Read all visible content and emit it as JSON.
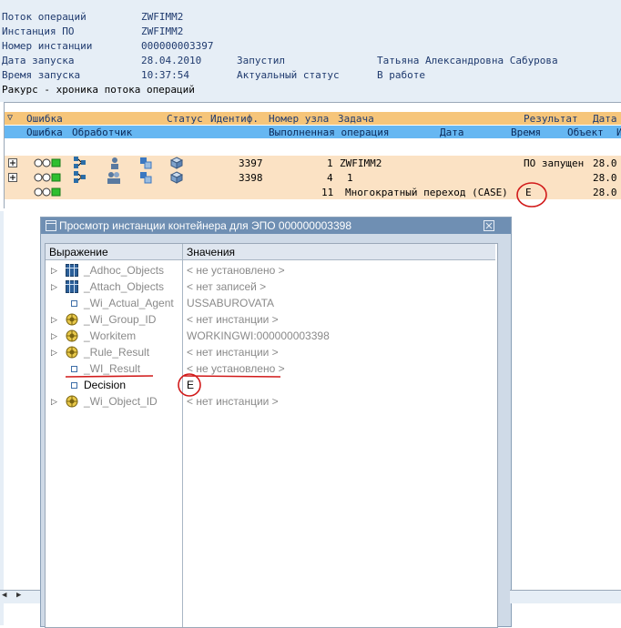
{
  "header": {
    "rows": [
      {
        "label": "Поток операций",
        "value": "ZWFIMM2"
      },
      {
        "label": "Инстанция ПО",
        "value": "ZWFIMM2"
      },
      {
        "label": "Номер инстанции",
        "value": "000000003397"
      },
      {
        "label": "Дата запуска",
        "value": "28.04.2010",
        "label2": "Запустил",
        "value2": "Татьяна Александровна Сабурова"
      },
      {
        "label": "Время запуска",
        "value": "10:37:54",
        "label2": "Актуальный статус",
        "value2": "В работе"
      }
    ],
    "section_title": "Ракурс - хроника потока операций"
  },
  "table": {
    "header1": [
      "Ошибка",
      "Статус",
      "Идентиф.",
      "Номер узла",
      "Задача",
      "Результат",
      "Дата"
    ],
    "header2": [
      "Ошибка",
      "Обработчик",
      "Выполненная операция",
      "Дата",
      "Время",
      "Объект",
      "И"
    ],
    "rows": [
      {
        "id": "3397",
        "node": "1",
        "task": "ZWFIMM2",
        "result": "ПО запущен",
        "date": "28.0"
      },
      {
        "id": "3398",
        "node": "4",
        "task": "1",
        "result": "",
        "date": "28.0"
      },
      {
        "id": "",
        "node": "11",
        "task": "Многократный переход (CASE)",
        "result": "E",
        "date": "28.0"
      }
    ]
  },
  "dialog": {
    "title": "Просмотр инстанции контейнера для ЭПО 000000003398",
    "col_expression": "Выражение",
    "col_values": "Значения",
    "rows": [
      {
        "name": "_Adhoc_Objects",
        "value": "< не установлено >",
        "icon": "table-icon",
        "expand": true
      },
      {
        "name": "_Attach_Objects",
        "value": "< нет записей >",
        "icon": "table-icon",
        "expand": true
      },
      {
        "name": "_Wi_Actual_Agent",
        "value": "USSABUROVATA",
        "icon": "square-icon",
        "expand": false
      },
      {
        "name": "_Wi_Group_ID",
        "value": "< нет инстанции >",
        "icon": "object-icon",
        "expand": true
      },
      {
        "name": "_Workitem",
        "value": "WORKINGWI:000000003398",
        "icon": "object-icon",
        "expand": true
      },
      {
        "name": "_Rule_Result",
        "value": "< нет инстанции >",
        "icon": "object-icon",
        "expand": true
      },
      {
        "name": "_WI_Result",
        "value": "< не установлено >",
        "icon": "square-icon",
        "expand": false
      },
      {
        "name": "Decision",
        "value": "E",
        "icon": "square-icon",
        "expand": false
      },
      {
        "name": "_Wi_Object_ID",
        "value": "< нет инстанции >",
        "icon": "object-icon",
        "expand": true
      }
    ]
  },
  "colors": {
    "header_bg": "#e6eef6",
    "orange_band": "#f6c57a",
    "blue_band": "#66b7f2",
    "row_bg": "#fbe2c4",
    "annotation_red": "#d11a1a",
    "dialog_title_bg": "#6f8fb3"
  }
}
